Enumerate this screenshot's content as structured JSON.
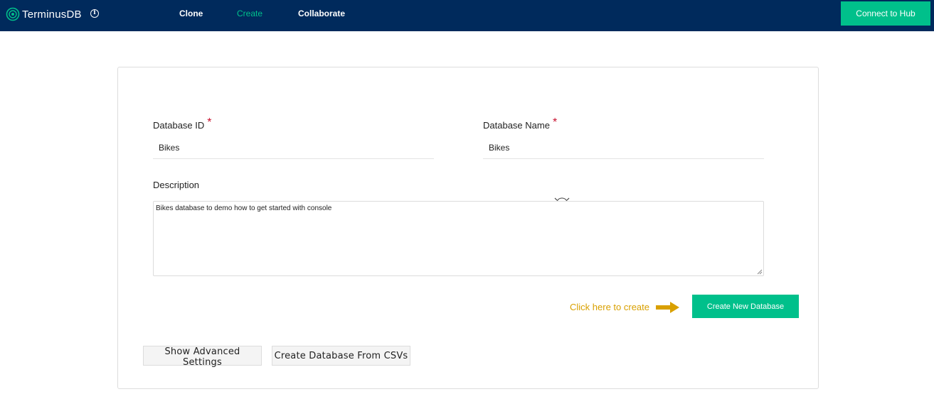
{
  "header": {
    "brand": "TerminusDB",
    "nav": [
      {
        "label": "Clone",
        "active": false
      },
      {
        "label": "Create",
        "active": true
      },
      {
        "label": "Collaborate",
        "active": false
      }
    ],
    "hub_button": "Connect to Hub"
  },
  "form": {
    "database_id": {
      "label": "Database ID",
      "required_mark": "*",
      "value": "Bikes"
    },
    "database_name": {
      "label": "Database Name",
      "required_mark": "*",
      "value": "Bikes"
    },
    "description": {
      "label": "Description",
      "value": "Bikes database to demo how to get started with console"
    },
    "hint": "Click here to create",
    "create_button": "Create New Database",
    "advanced_button": "Show Advanced Settings",
    "csv_button": "Create Database From CSVs"
  },
  "colors": {
    "navbar": "#002a5c",
    "accent": "#00c08b",
    "hint": "#d9a000",
    "required": "#c8102e"
  }
}
